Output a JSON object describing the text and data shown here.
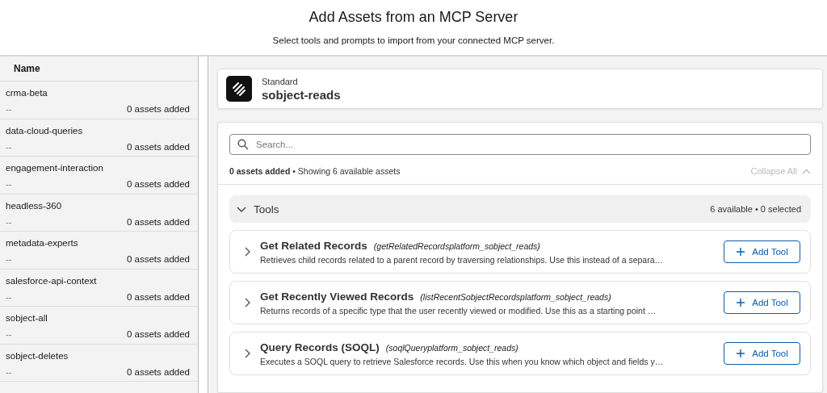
{
  "header": {
    "title": "Add Assets from an MCP Server",
    "subtitle": "Select tools and prompts to import from your connected MCP server."
  },
  "sidebar": {
    "column": "Name",
    "items": [
      {
        "name": "crma-beta",
        "description": "--",
        "count": "0 assets added",
        "selected": false
      },
      {
        "name": "data-cloud-queries",
        "description": "--",
        "count": "0 assets added",
        "selected": false
      },
      {
        "name": "engagement-interaction",
        "description": "--",
        "count": "0 assets added",
        "selected": false
      },
      {
        "name": "headless-360",
        "description": "--",
        "count": "0 assets added",
        "selected": false
      },
      {
        "name": "metadata-experts",
        "description": "--",
        "count": "0 assets added",
        "selected": false
      },
      {
        "name": "salesforce-api-context",
        "description": "--",
        "count": "0 assets added",
        "selected": false
      },
      {
        "name": "sobject-all",
        "description": "--",
        "count": "0 assets added",
        "selected": false
      },
      {
        "name": "sobject-deletes",
        "description": "--",
        "count": "0 assets added",
        "selected": false
      }
    ]
  },
  "server": {
    "type": "Standard",
    "name": "sobject-reads"
  },
  "search": {
    "placeholder": "Search..."
  },
  "summary": {
    "added": "0 assets added",
    "showing": "• Showing 6 available assets",
    "collapse_all": "Collapse All",
    "collapse_disabled": true
  },
  "group": {
    "title": "Tools",
    "counts": "6 available • 0 selected",
    "expanded": true,
    "tools": [
      {
        "title": "Get Related Records",
        "api_name": "(getRelatedRecordsplatform_sobject_reads)",
        "description": "Retrieves child records related to a parent record by traversing relationships. Use this instead of a separa…",
        "expanded": false,
        "button": "Add Tool"
      },
      {
        "title": "Get Recently Viewed Records",
        "api_name": "(listRecentSobjectRecordsplatform_sobject_reads)",
        "description": "Returns records of a specific type that the user recently viewed or modified. Use this as a starting point …",
        "expanded": false,
        "button": "Add Tool"
      },
      {
        "title": "Query Records (SOQL)",
        "api_name": "(soqlQueryplatform_sobject_reads)",
        "description": "Executes a SOQL query to retrieve Salesforce records. Use this when you know which object and fields y…",
        "expanded": false,
        "button": "Add Tool"
      }
    ]
  }
}
